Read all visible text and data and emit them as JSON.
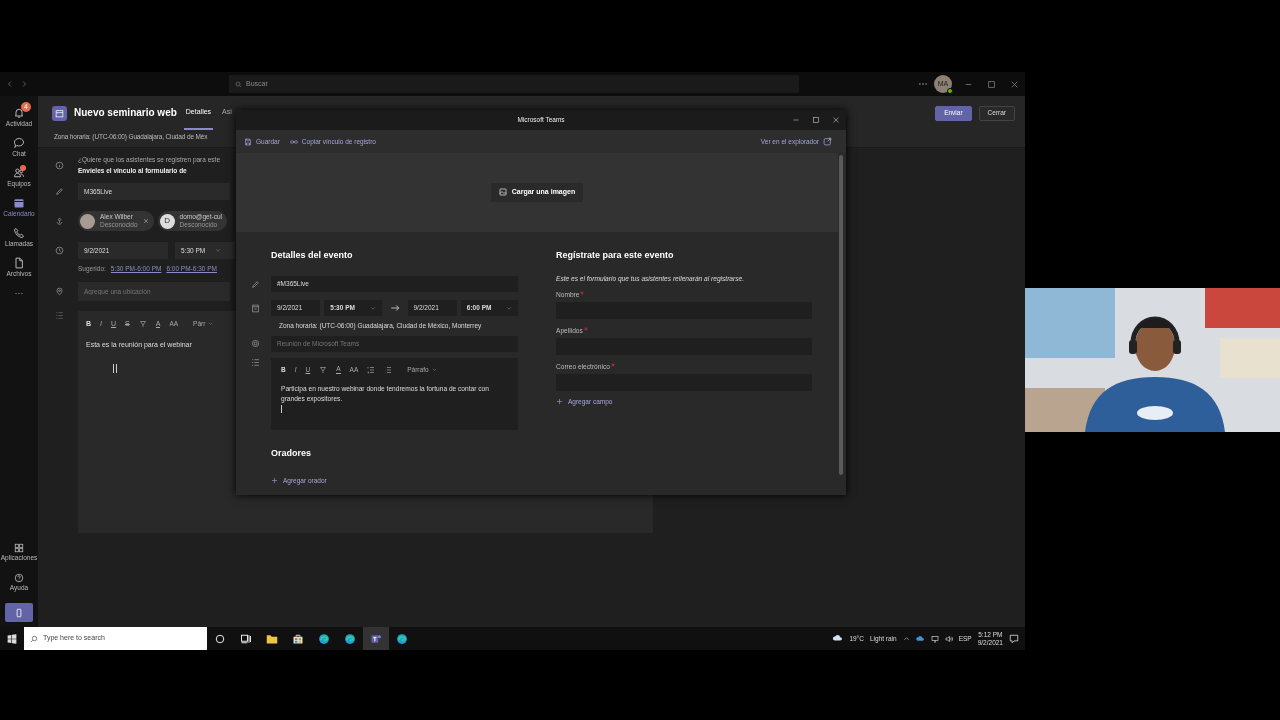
{
  "teams": {
    "search": {
      "placeholder": "Buscar"
    },
    "account": {
      "initials": "MA"
    },
    "rail": [
      {
        "label": "Actividad",
        "kind": "bell",
        "badge": "4",
        "selected": false
      },
      {
        "label": "Chat",
        "kind": "chat",
        "selected": false
      },
      {
        "label": "Equipos",
        "kind": "team",
        "alert": true,
        "selected": false
      },
      {
        "label": "Calendario",
        "kind": "calendar",
        "selected": true
      },
      {
        "label": "Llamadas",
        "kind": "phone",
        "selected": false
      },
      {
        "label": "Archivos",
        "kind": "file",
        "selected": false
      }
    ],
    "rail_more": "···",
    "rail_bottom": [
      {
        "label": "Aplicaciones",
        "kind": "apps"
      },
      {
        "label": "Ayuda",
        "kind": "help"
      }
    ],
    "title": "Nuevo seminario web",
    "tabs": [
      {
        "label": "Detalles",
        "selected": true
      },
      {
        "label": "Asi",
        "selected": false
      }
    ],
    "buttons": [
      {
        "label": "Enviar",
        "kind": "primary"
      },
      {
        "label": "Cerrar",
        "kind": "secondary"
      }
    ],
    "timezone": "Zona horaria: (UTC-06:00) Guadalajara, Ciudad de Méx",
    "info": [
      "¿Quiere que los asistentes se registren para este",
      "Envíeles el vínculo al formulario de"
    ],
    "meeting_title": "M365Live",
    "attendees": [
      {
        "name": "Alex Wilber",
        "status": "Desconocido"
      },
      {
        "name": "domo@get-cul",
        "status": "Desconocido",
        "kind": "initial",
        "initial": "D"
      }
    ],
    "date": "9/2/2021",
    "time": "5:30 PM",
    "suggested_label": "Sugerido:",
    "suggested": [
      "5:30 PM-6:00 PM",
      "6:00 PM-6:30 PM"
    ],
    "location": {
      "placeholder": "Agregue una ubicación"
    },
    "toolbar": [
      {
        "kind": "bold",
        "text": "B"
      },
      {
        "kind": "italic",
        "text": "I"
      },
      {
        "kind": "underline",
        "text": "U"
      },
      {
        "kind": "strike",
        "text": "S"
      },
      {
        "kind": "highlight"
      },
      {
        "kind": "font-color",
        "text": "A"
      },
      {
        "kind": "font-size",
        "text": "AA"
      },
      {
        "kind": "style",
        "text": "Párr"
      }
    ],
    "body": "Esta es la reunión para el webinar"
  },
  "dialog": {
    "title": "Microsoft Teams",
    "actions": [
      {
        "label": "Guardar",
        "kind": "save"
      },
      {
        "label": "Copiar vínculo de registro",
        "kind": "link"
      }
    ],
    "browser_link": "Ver en el explorador",
    "upload": "Cargar una imagen",
    "details": {
      "heading": "Detalles del evento",
      "title": "#M365Live",
      "start_date": "9/2/2021",
      "start_time": "5:30 PM",
      "end_date": "9/2/2021",
      "end_time": "6:00 PM",
      "timezone": "Zona horaria: (UTC-06:00) Guadalajara, Ciudad de México, Monterrey",
      "location": {
        "placeholder": "Reunión de Microsoft Teams"
      },
      "toolbar": [
        {
          "kind": "bold",
          "text": "B"
        },
        {
          "kind": "italic",
          "text": "I"
        },
        {
          "kind": "underline",
          "text": "U"
        },
        {
          "kind": "highlight"
        },
        {
          "kind": "font-color",
          "text": "A"
        },
        {
          "kind": "font-size",
          "text": "AA"
        },
        {
          "kind": "numbered"
        },
        {
          "kind": "bulleted"
        },
        {
          "kind": "style",
          "text": "Párrafo"
        }
      ],
      "description": "Participa en nuestro webinar donde tendremos la fortuna de contar con grandes expositores.",
      "speakers_heading": "Oradores",
      "add_speaker": "Agregar orador"
    },
    "registration": {
      "heading": "Regístrate para este evento",
      "note": "Este es el formulario que tus asistentes rellenarán al registrarse.",
      "fields": [
        {
          "label": "Nombre",
          "required": true
        },
        {
          "label": "Apellidos",
          "required": true
        },
        {
          "label": "Correo electrónico",
          "required": true
        }
      ],
      "add_field": "Agregar campo"
    }
  },
  "taskbar": {
    "search": {
      "placeholder": "Type here to search"
    },
    "apps": [
      {
        "kind": "cortana",
        "active": false
      },
      {
        "kind": "taskview",
        "active": false
      },
      {
        "kind": "folder",
        "active": false
      },
      {
        "kind": "store",
        "active": false
      },
      {
        "kind": "edge",
        "active": false
      },
      {
        "kind": "edge",
        "active": false
      },
      {
        "kind": "teams",
        "active": true
      },
      {
        "kind": "edge",
        "active": false
      }
    ],
    "temperature": "19°C",
    "weather": "Light rain",
    "language": "ESP",
    "time": "5:12 PM",
    "date": "9/2/2021"
  }
}
